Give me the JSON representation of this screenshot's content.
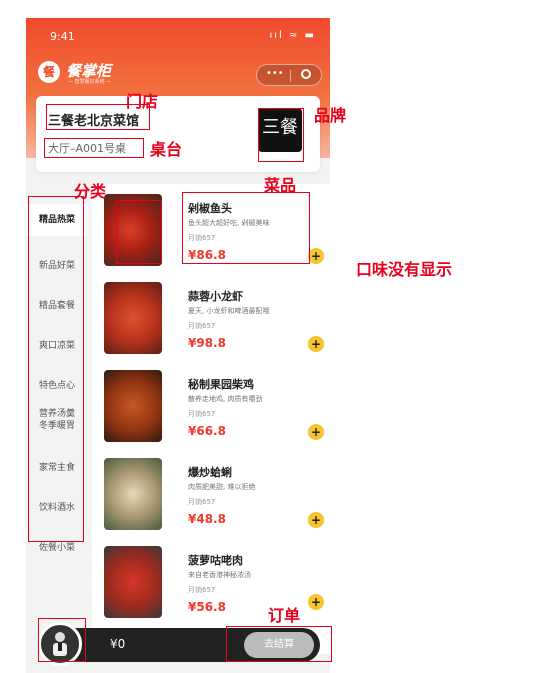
{
  "status_bar": {
    "time": "9:41",
    "icons": "ııl ≈ ▬"
  },
  "app": {
    "logo_text": "餐掌柜",
    "logo_sub": "— 智慧餐饮系统 —"
  },
  "store": {
    "name": "三餐老北京菜馆",
    "table": "大厅–A001号桌",
    "brand_text": "三餐"
  },
  "categories": [
    "精品热菜",
    "新品好菜",
    "精品套餐",
    "爽口凉菜",
    "特色点心",
    "营养汤羹 冬季暖胃",
    "家常主食",
    "饮料酒水",
    "佐餐小菜"
  ],
  "dishes": [
    {
      "name": "剁椒鱼头",
      "desc": "鱼头超大超好吃, 剁椒美味",
      "sales": "月销657",
      "price": "¥86.8"
    },
    {
      "name": "蒜蓉小龙虾",
      "desc": "夏天, 小龙虾和啤酒最配哦",
      "sales": "月销657",
      "price": "¥98.8"
    },
    {
      "name": "秘制果园柴鸡",
      "desc": "散养走地鸡, 肉质有嚼劲",
      "sales": "月销657",
      "price": "¥66.8"
    },
    {
      "name": "爆炒蛤蜊",
      "desc": "肉质肥美甜, 难以拒绝",
      "sales": "月销657",
      "price": "¥48.8"
    },
    {
      "name": "菠萝咕咾肉",
      "desc": "来自老香港神秘浓汤",
      "sales": "月销657",
      "price": "¥56.8"
    }
  ],
  "cart": {
    "total": "¥0",
    "checkout_label": "去结算"
  },
  "annotations": {
    "store": "门店",
    "brand": "品牌",
    "table": "桌台",
    "category": "分类",
    "dish": "菜品",
    "taste": "口味没有显示",
    "order": "订单"
  },
  "colors": {
    "accent": "#ef4a2c",
    "price": "#f0392b",
    "add_button": "#f7c52c",
    "annotation": "#e8001c"
  }
}
